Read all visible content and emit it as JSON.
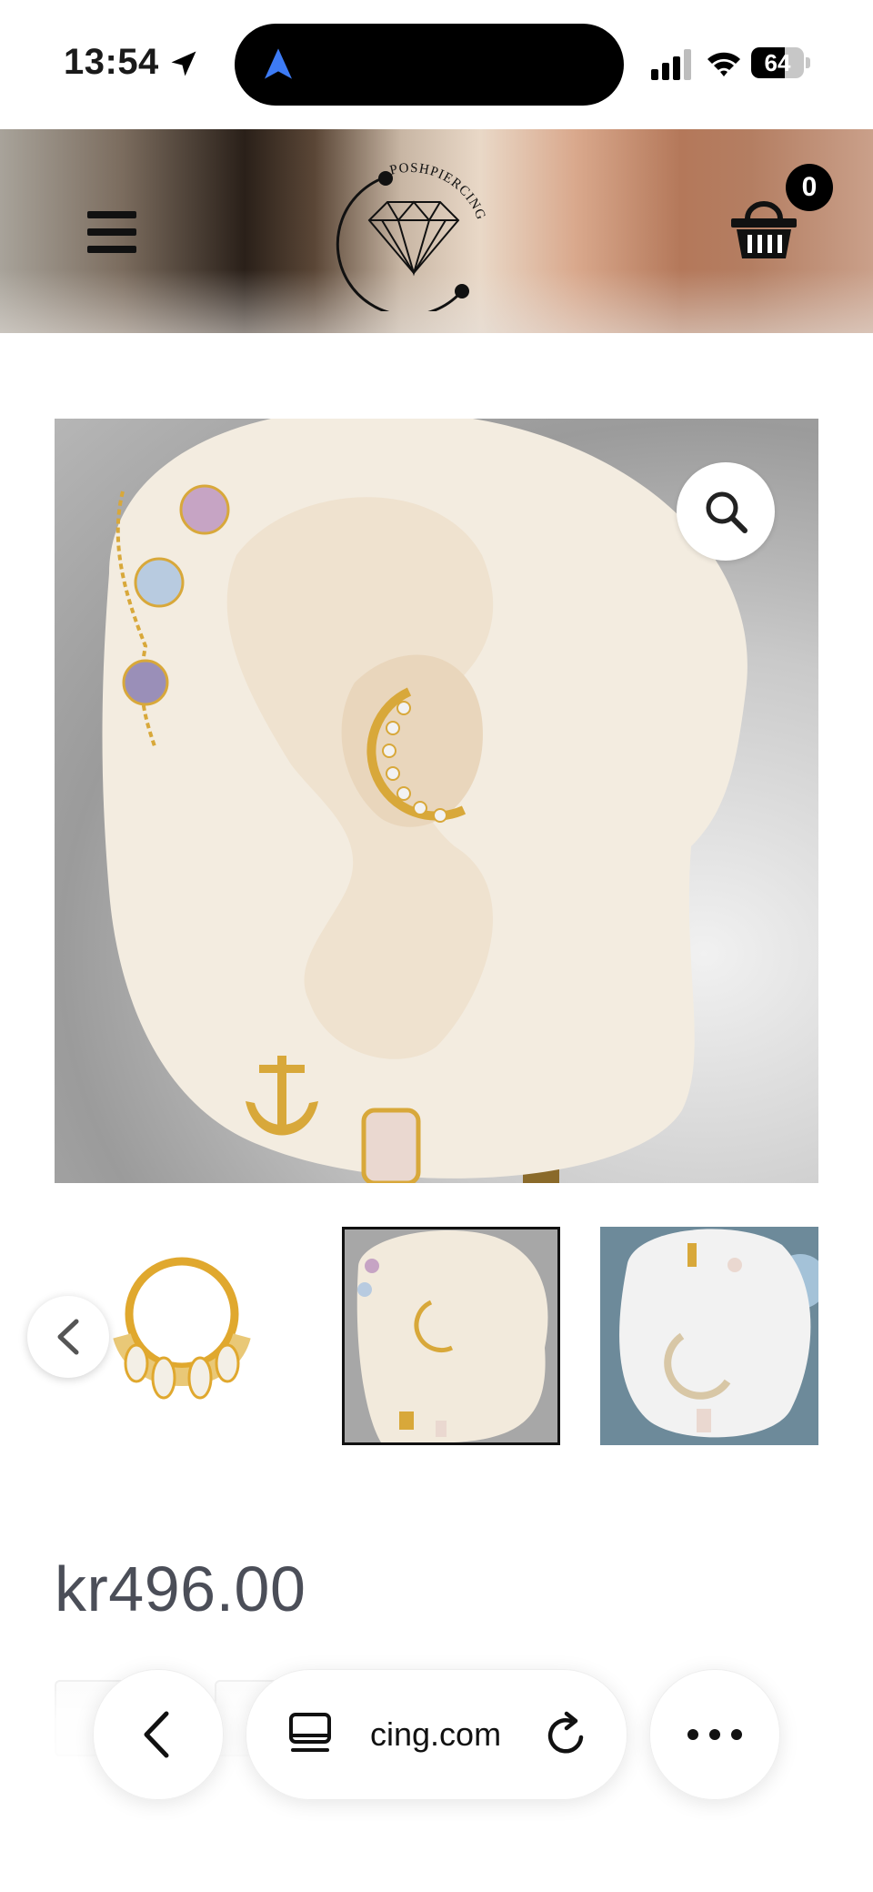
{
  "status_bar": {
    "time": "13:54",
    "battery": "64",
    "battery_level": 0.64
  },
  "header": {
    "brand": "POSHPIERCING",
    "cart_count": "0"
  },
  "product": {
    "price": "kr496.00"
  },
  "browser": {
    "url": "cing.com"
  },
  "colors": {
    "header_left": "#2a2019",
    "header_right": "#b4785a",
    "price": "#4b4e58",
    "accent_blue": "#3d7bf5"
  }
}
